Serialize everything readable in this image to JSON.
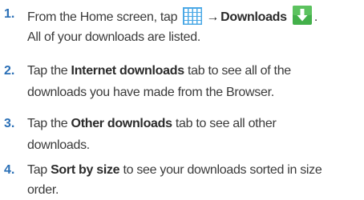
{
  "icons": {
    "apps": "apps-grid-icon",
    "downloads": "download-arrow-icon",
    "apps_color": "#4aa8e6",
    "downloads_color": "#43b04a"
  },
  "steps": [
    {
      "number": "1.",
      "pre": "From the Home screen, tap",
      "arrow": "→",
      "bold": "Downloads",
      "post": ".",
      "line2": "All of your downloads are listed."
    },
    {
      "number": "2.",
      "pre": "Tap the",
      "bold": "Internet downloads",
      "post": "tab to see all of the",
      "line2": "downloads you have made from the Browser."
    },
    {
      "number": "3.",
      "pre": "Tap the",
      "bold": "Other downloads",
      "post": "tab to see all other",
      "line2": "downloads."
    },
    {
      "number": "4.",
      "pre": "Tap",
      "bold": "Sort by size",
      "post": "to see your downloads sorted in size",
      "line2": "order."
    }
  ]
}
